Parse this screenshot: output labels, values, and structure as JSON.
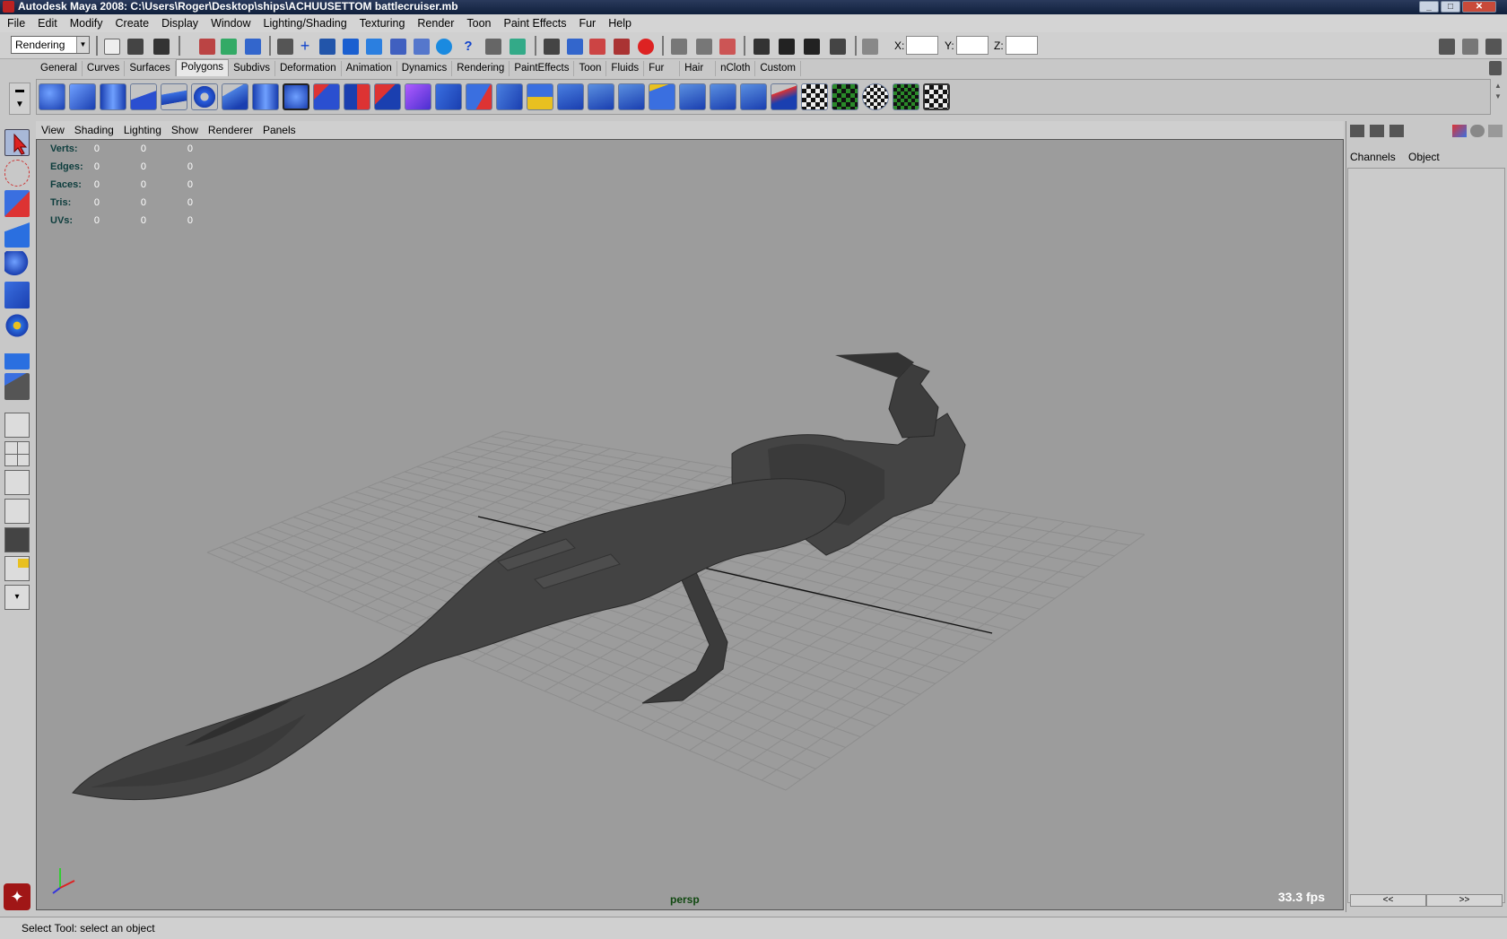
{
  "window": {
    "title": "Autodesk Maya 2008: C:\\Users\\Roger\\Desktop\\ships\\ACHUUSETTOM battlecruiser.mb"
  },
  "menu": [
    "File",
    "Edit",
    "Modify",
    "Create",
    "Display",
    "Window",
    "Lighting/Shading",
    "Texturing",
    "Render",
    "Toon",
    "Paint Effects",
    "Fur",
    "Help"
  ],
  "statusline": {
    "menuset": "Rendering",
    "x_label": "X:",
    "y_label": "Y:",
    "z_label": "Z:"
  },
  "shelf_tabs": [
    "General",
    "Curves",
    "Surfaces",
    "Polygons",
    "Subdivs",
    "Deformation",
    "Animation",
    "Dynamics",
    "Rendering",
    "PaintEffects",
    "Toon",
    "Fluids",
    "Fur",
    "Hair",
    "nCloth",
    "Custom"
  ],
  "active_shelf_tab": "Polygons",
  "panel_menu": [
    "View",
    "Shading",
    "Lighting",
    "Show",
    "Renderer",
    "Panels"
  ],
  "hud": {
    "rows": [
      {
        "label": "Verts:",
        "values": [
          "0",
          "0",
          "0"
        ]
      },
      {
        "label": "Edges:",
        "values": [
          "0",
          "0",
          "0"
        ]
      },
      {
        "label": "Faces:",
        "values": [
          "0",
          "0",
          "0"
        ]
      },
      {
        "label": "Tris:",
        "values": [
          "0",
          "0",
          "0"
        ]
      },
      {
        "label": "UVs:",
        "values": [
          "0",
          "0",
          "0"
        ]
      }
    ],
    "camera": "persp",
    "fps": "33.3 fps"
  },
  "channel_box": {
    "tabs": [
      "Channels",
      "Object"
    ],
    "nav_prev": "<<",
    "nav_next": ">>"
  },
  "help_line": "Select Tool: select an object",
  "colors": {
    "viewport_bg": "#9c9c9c",
    "grid": "#8a8a8a",
    "model": "#3a3a3a",
    "hud_label": "#0d3d3d"
  }
}
